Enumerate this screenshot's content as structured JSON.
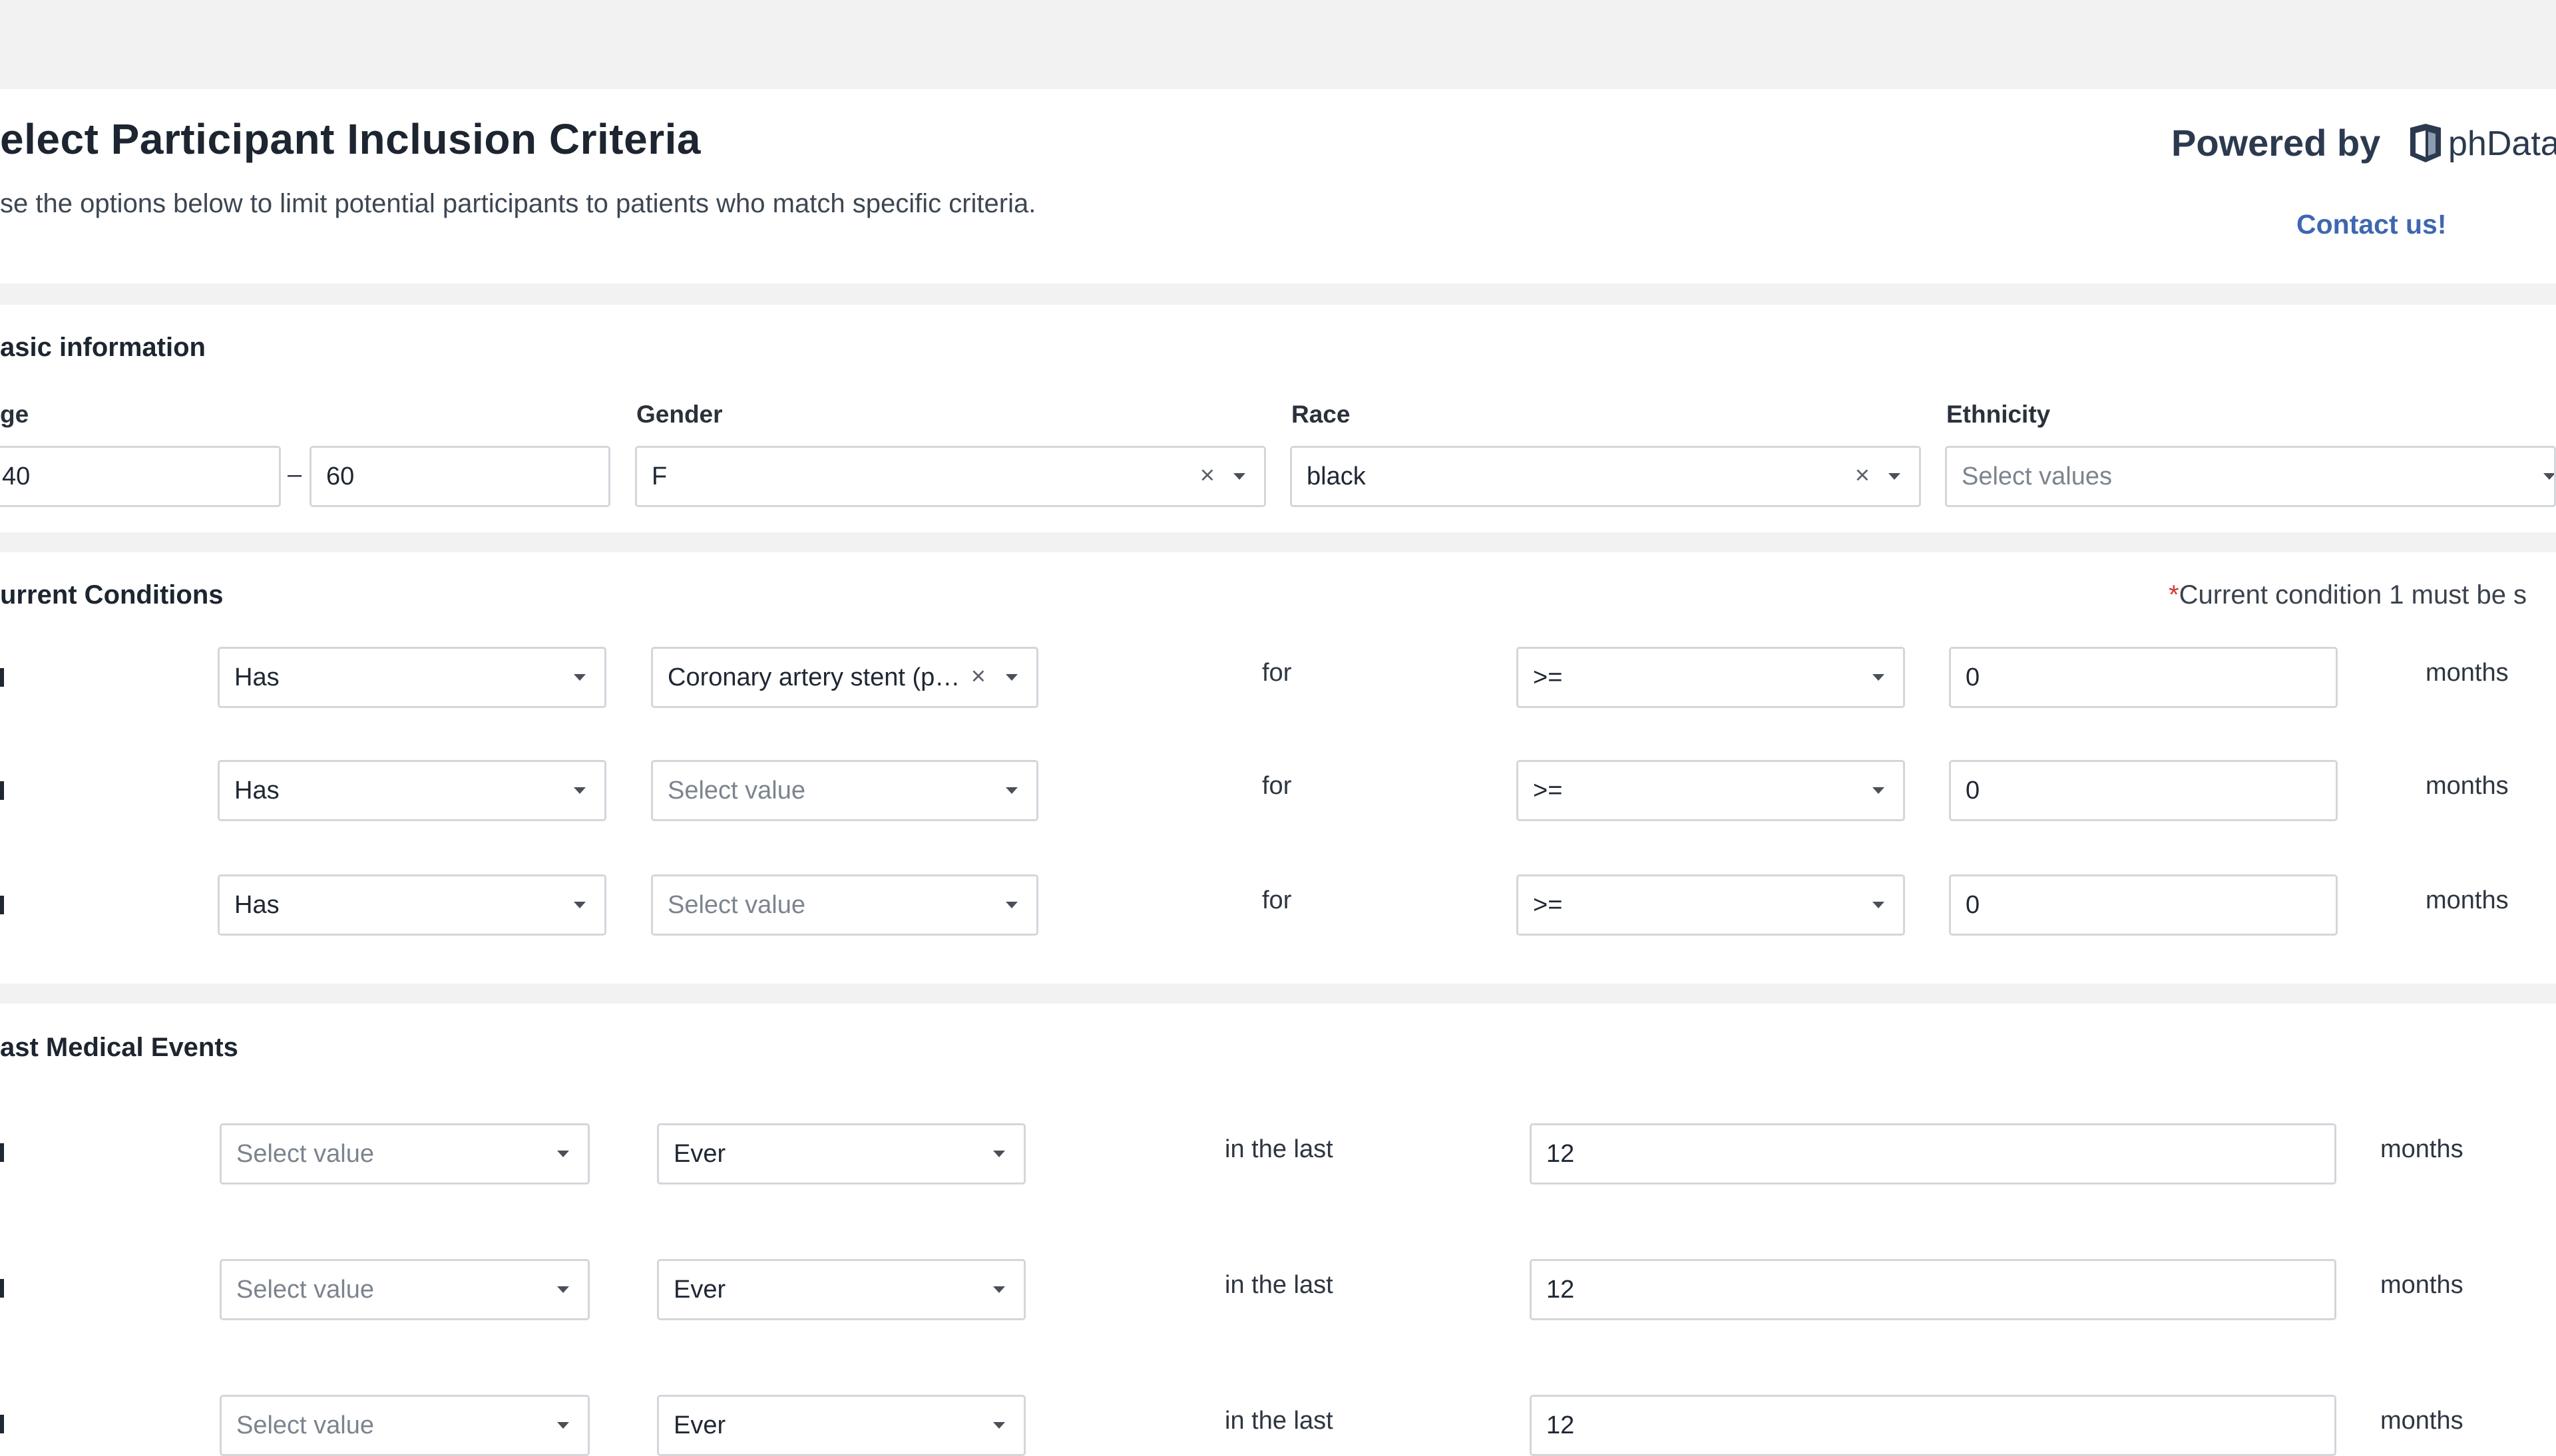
{
  "header": {
    "title": "elect Participant Inclusion Criteria",
    "subtitle": "se the options below to limit potential participants to patients who match specific criteria.",
    "powered_by": "Powered by",
    "brand": "phData",
    "contact": "Contact us!"
  },
  "basic": {
    "section_title": "asic information",
    "age_label": "ge",
    "age_min": "40",
    "age_separator": "–",
    "age_max": "60",
    "gender_label": "Gender",
    "gender_value": "F",
    "race_label": "Race",
    "race_value": "black",
    "ethnicity_label": "Ethnicity",
    "ethnicity_placeholder": "Select values",
    "clear_symbol": "×"
  },
  "current_conditions": {
    "section_title": "urrent Conditions",
    "note_star": "*",
    "note": "Current condition 1 must be s",
    "rows": [
      {
        "qualifier": "Has",
        "condition": "Coronary artery stent (p…",
        "condition_is_placeholder": false,
        "for_text": "for",
        "operator": ">=",
        "amount": "0",
        "unit": "months"
      },
      {
        "qualifier": "Has",
        "condition": "Select value",
        "condition_is_placeholder": true,
        "for_text": "for",
        "operator": ">=",
        "amount": "0",
        "unit": "months"
      },
      {
        "qualifier": "Has",
        "condition": "Select value",
        "condition_is_placeholder": true,
        "for_text": "for",
        "operator": ">=",
        "amount": "0",
        "unit": "months"
      }
    ]
  },
  "past_events": {
    "section_title": "ast Medical Events",
    "rows": [
      {
        "event": "Select value",
        "frequency": "Ever",
        "window_text": "in the last",
        "amount": "12",
        "unit": "months"
      },
      {
        "event": "Select value",
        "frequency": "Ever",
        "window_text": "in the last",
        "amount": "12",
        "unit": "months"
      },
      {
        "event": "Select value",
        "frequency": "Ever",
        "window_text": "in the last",
        "amount": "12",
        "unit": "months"
      }
    ]
  },
  "colors": {
    "band": "#f2f2f2",
    "accent_link": "#3e67b1",
    "required_star": "#d13838",
    "border": "#d3d6db"
  }
}
